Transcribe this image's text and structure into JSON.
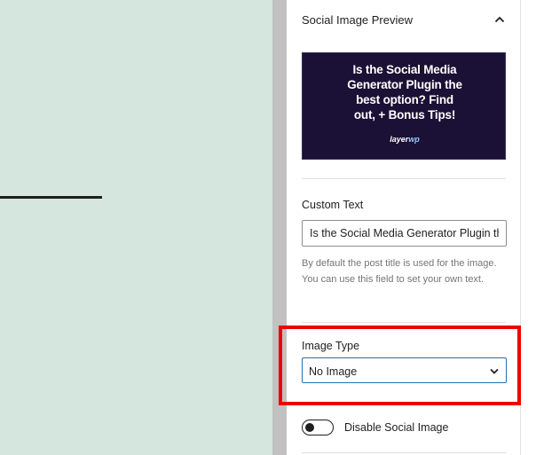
{
  "panel": {
    "title": "Social Image Preview",
    "toggle_icon": "chevron-up-icon"
  },
  "preview": {
    "headline_lines": [
      "Is the Social Media",
      "Generator Plugin the",
      "best option? Find",
      "out, + Bonus Tips!"
    ],
    "logo_primary": "layer",
    "logo_accent": "wp",
    "colors": {
      "background": "#1b1035",
      "text": "#ffffff",
      "logo_accent": "#8fd0ff"
    }
  },
  "custom_text": {
    "label": "Custom Text",
    "value": "Is the Social Media Generator Plugin the best option? Find out, + Bonus Tips!",
    "help": "By default the post title is used for the image. You can use this field to set your own text."
  },
  "image_type": {
    "label": "Image Type",
    "selected": "No Image",
    "icon": "chevron-down-icon"
  },
  "disable_social_image": {
    "label": "Disable Social Image",
    "enabled": false
  },
  "colors": {
    "canvas_background": "#d4e6dd",
    "highlight": "#ee0000",
    "focus_border": "#2271b1"
  }
}
